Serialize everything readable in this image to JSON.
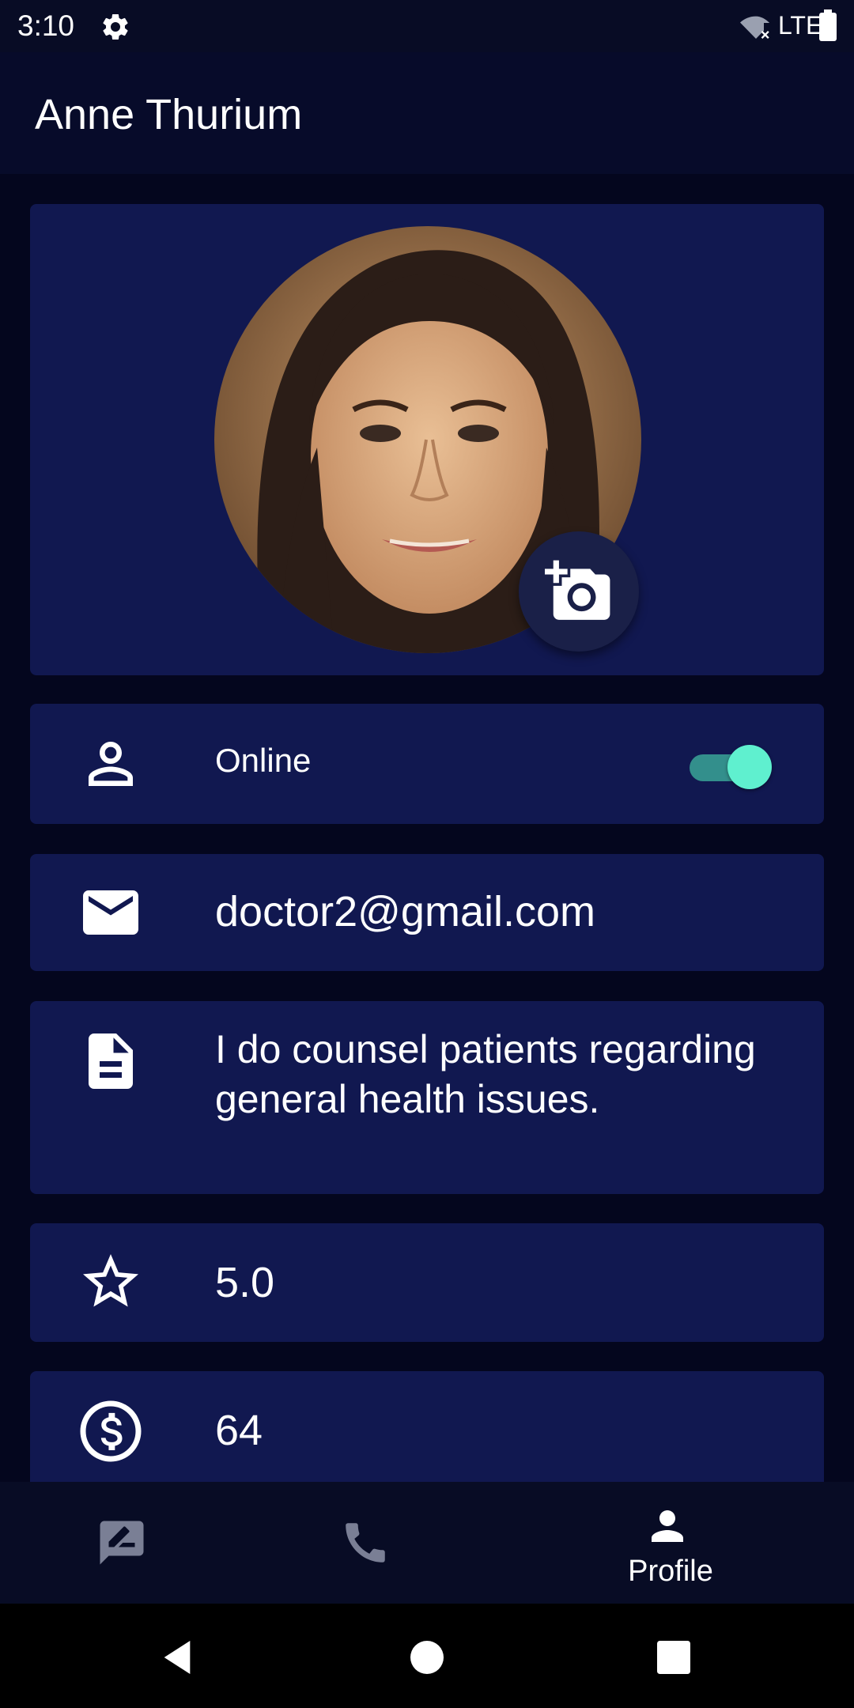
{
  "status_bar": {
    "time": "3:10",
    "network": "LTE",
    "icons": [
      "settings-gear-icon",
      "wifi-off-icon",
      "battery-icon"
    ]
  },
  "app_bar": {
    "title": "Anne Thurium"
  },
  "profile": {
    "photo_alt": "profile-photo",
    "change_photo_icon": "add-photo-camera-icon",
    "online": {
      "label": "Online",
      "enabled": true,
      "icon": "person-outline-icon"
    },
    "email": {
      "value": "doctor2@gmail.com",
      "icon": "email-icon"
    },
    "bio": {
      "value": "I do counsel patients regarding general health issues.",
      "icon": "description-icon"
    },
    "rating": {
      "value": "5.0",
      "icon": "star-outline-icon"
    },
    "fee": {
      "value": "64",
      "icon": "dollar-circle-icon"
    }
  },
  "bottom_nav": {
    "items": [
      {
        "icon": "rate-review-chat-icon",
        "label": "",
        "active": false
      },
      {
        "icon": "phone-icon",
        "label": "",
        "active": false
      },
      {
        "icon": "person-icon",
        "label": "Profile",
        "active": true
      }
    ]
  },
  "colors": {
    "background": "#04061e",
    "card": "#111850",
    "app_bar": "#070b2a",
    "toggle_thumb": "#5ff0cf",
    "toggle_track": "#3aa597",
    "inactive_icon": "#7a7f95"
  },
  "system_nav": {
    "buttons": [
      "back-icon",
      "home-icon",
      "recents-icon"
    ]
  }
}
